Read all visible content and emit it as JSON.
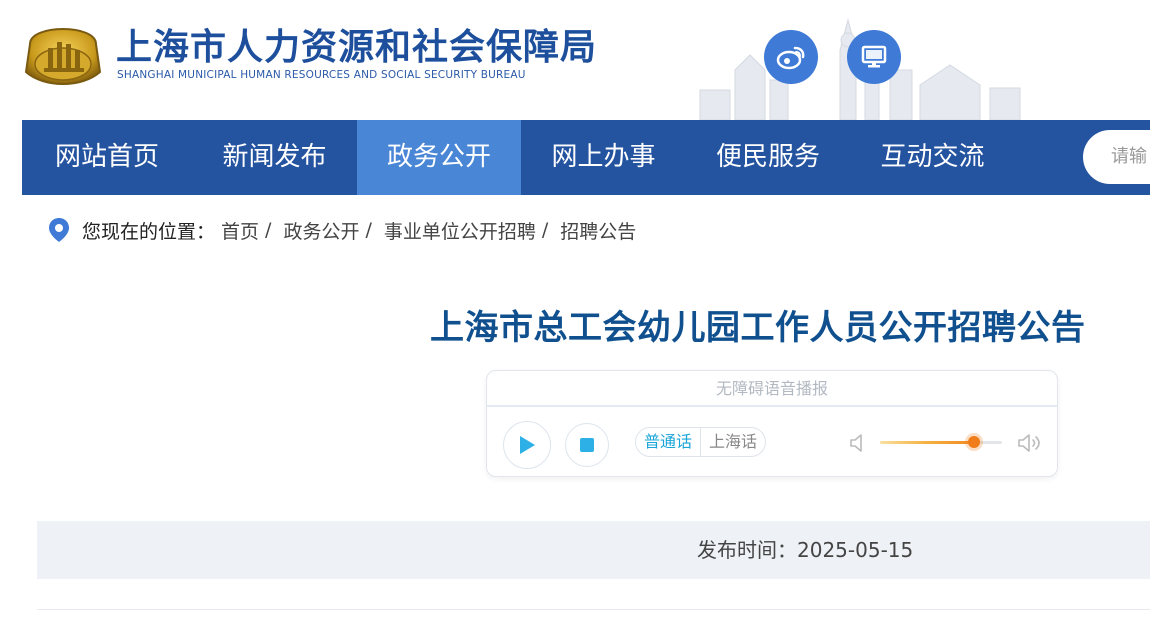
{
  "header": {
    "title_cn": "上海市人力资源和社会保障局",
    "title_en": "SHANGHAI MUNICIPAL HUMAN RESOURCES AND SOCIAL SECURITY BUREAU",
    "icons": [
      "logo-emblem",
      "weibo-icon",
      "desktop-monitor-icon"
    ]
  },
  "nav": {
    "items": [
      {
        "label": "网站首页"
      },
      {
        "label": "新闻发布"
      },
      {
        "label": "政务公开",
        "active": true
      },
      {
        "label": "网上办事"
      },
      {
        "label": "便民服务"
      },
      {
        "label": "互动交流"
      }
    ],
    "search_placeholder": "请输"
  },
  "breadcrumb": {
    "label": "您现在的位置：",
    "items": [
      "首页",
      "政务公开",
      "事业单位公开招聘",
      "招聘公告"
    ],
    "separator": "/"
  },
  "article": {
    "title": "上海市总工会幼儿园工作人员公开招聘公告",
    "publish_label": "发布时间：",
    "publish_date": "2025-05-15"
  },
  "player": {
    "header": "无障碍语音播报",
    "languages": [
      "普通话",
      "上海话"
    ],
    "selected_language": "普通话",
    "volume": 0.77,
    "accent_color": "#1aa5d8",
    "volume_color": "#f07d1a"
  },
  "colors": {
    "nav_bg": "#2453a0",
    "nav_active": "#4a86d6",
    "title": "#10508f"
  }
}
